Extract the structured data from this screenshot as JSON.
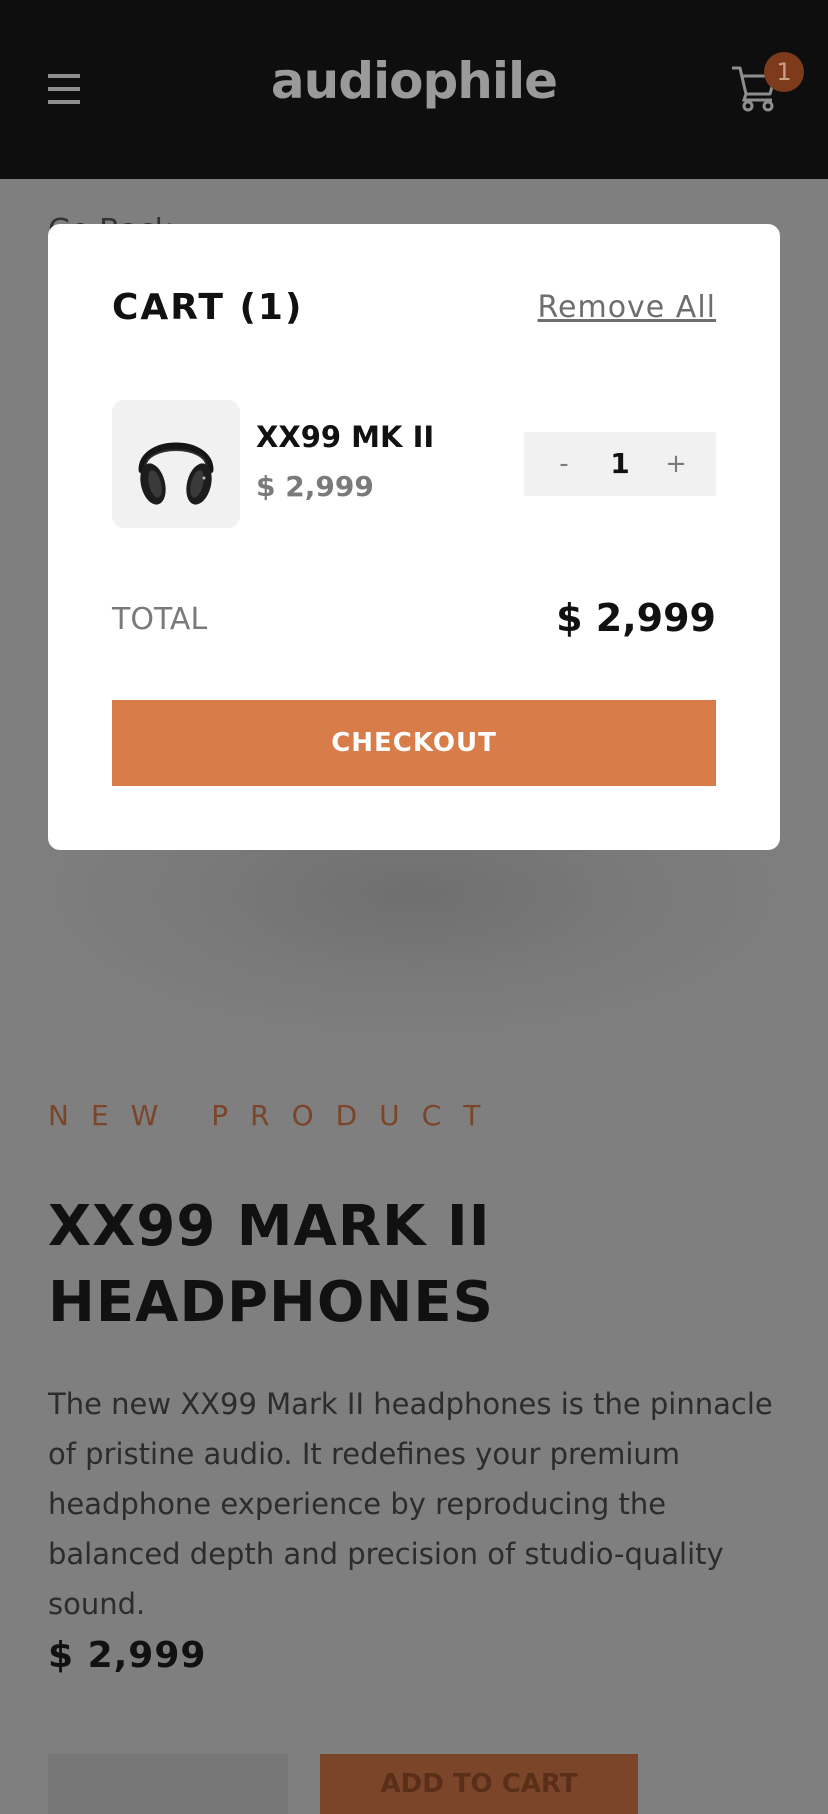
{
  "header": {
    "logo": "audiophile",
    "cart_count": "1"
  },
  "page": {
    "go_back": "Go Back",
    "overline": "NEW PRODUCT",
    "title": "XX99 MARK II HEADPHONES",
    "description": "The new XX99 Mark II headphones is the pinnacle of pristine audio. It redefines your premium headphone experience by reproducing the balanced depth and precision of studio-quality sound.",
    "price": "$ 2,999",
    "add_to_cart": "ADD TO CART"
  },
  "cart": {
    "title": "CART (1)",
    "remove_all": "Remove All",
    "items": [
      {
        "name": "XX99 MK II",
        "price": "$ 2,999",
        "quantity": "1",
        "minus": "-",
        "plus": "+"
      }
    ],
    "total_label": "TOTAL",
    "total_value": "$ 2,999",
    "checkout_label": "CHECKOUT"
  },
  "colors": {
    "accent": "#d87d4a",
    "header_bg": "#0e0e0e",
    "overlay": "#7f7f7f"
  },
  "icons": [
    "hamburger-icon",
    "cart-icon",
    "headphones-thumbnail"
  ]
}
